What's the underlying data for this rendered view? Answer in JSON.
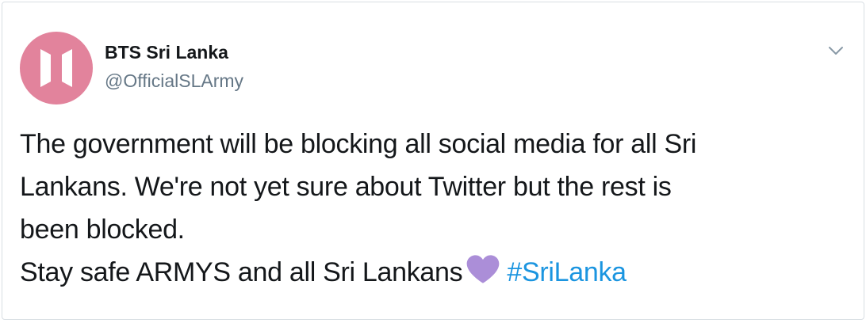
{
  "author": {
    "display_name": "BTS Sri Lanka",
    "handle": "@OfficialSLArmy",
    "avatar_icon": "bts-logo-icon",
    "avatar_color": "#e2839c"
  },
  "tweet": {
    "lines": [
      "The government will be blocking all social media for all Sri",
      "Lankans. We're not yet sure about Twitter but the rest is",
      "been blocked."
    ],
    "last_line_text": "Stay safe ARMYS and all Sri Lankans",
    "emoji": "purple-heart-icon",
    "emoji_color": "#ab8ed8",
    "hashtag": "#SriLanka",
    "hashtag_color": "#1b95e0"
  },
  "menu": {
    "caret_icon": "chevron-down-icon"
  }
}
